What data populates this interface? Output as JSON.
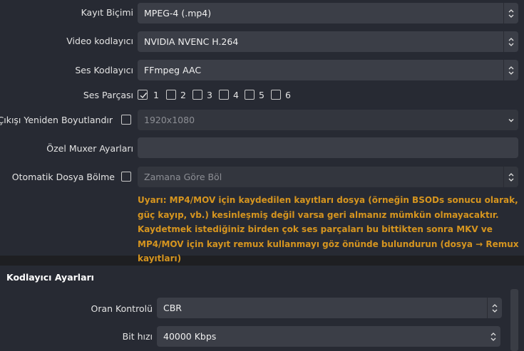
{
  "output": {
    "recording_format": {
      "label": "Kayıt Biçimi",
      "value": "MPEG-4 (.mp4)"
    },
    "video_encoder": {
      "label": "Video kodlayıcı",
      "value": "NVIDIA NVENC H.264"
    },
    "audio_encoder": {
      "label": "Ses Kodlayıcı",
      "value": "FFmpeg AAC"
    },
    "audio_track": {
      "label": "Ses Parçası",
      "tracks": [
        {
          "num": "1",
          "checked": true
        },
        {
          "num": "2",
          "checked": false
        },
        {
          "num": "3",
          "checked": false
        },
        {
          "num": "4",
          "checked": false
        },
        {
          "num": "5",
          "checked": false
        },
        {
          "num": "6",
          "checked": false
        }
      ]
    },
    "rescale_output": {
      "label": "Çıkışı Yeniden Boyutlandır",
      "value": "1920x1080",
      "checked": false
    },
    "custom_muxer": {
      "label": "Özel Muxer Ayarları",
      "value": ""
    },
    "auto_split": {
      "label": "Otomatik Dosya Bölme",
      "value": "Zamana Göre Böl",
      "checked": false
    },
    "warning": "Uyarı: MP4/MOV için kaydedilen kayıtları dosya (örneğin BSODs sonucu olarak, güç kayıp, vb.) kesinleşmiş değil varsa geri almanız mümkün olmayacaktır. Kaydetmek istediğiniz birden çok ses parçaları bu bittikten sonra MKV ve MP4/MOV için kayıt remux kullanmayı göz önünde bulundurun (dosya → Remux kayıtları)"
  },
  "encoder_settings": {
    "title": "Kodlayıcı Ayarları",
    "rate_control": {
      "label": "Oran Kontrolü",
      "value": "CBR"
    },
    "bitrate": {
      "label": "Bit hızı",
      "value": "40000 Kbps"
    }
  },
  "colors": {
    "warning": "#d6951f",
    "panel": "#272a33",
    "field": "#3b3e47"
  }
}
